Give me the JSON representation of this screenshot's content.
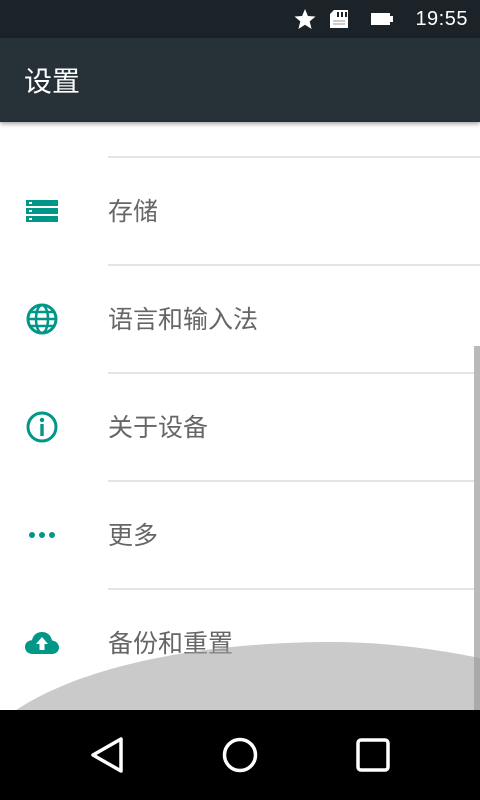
{
  "status_bar": {
    "time": "19:55",
    "icons": [
      "star-icon",
      "sd-card-icon",
      "battery-icon"
    ],
    "background": "#1b2328"
  },
  "toolbar": {
    "title": "设置",
    "background": "#263238"
  },
  "settings_items": [
    {
      "label": "存储",
      "icon": "storage-icon"
    },
    {
      "label": "语言和输入法",
      "icon": "globe-icon"
    },
    {
      "label": "关于设备",
      "icon": "info-icon"
    },
    {
      "label": "更多",
      "icon": "more-dots-icon"
    },
    {
      "label": "备份和重置",
      "icon": "cloud-upload-icon"
    }
  ],
  "accent_color": "#009688",
  "nav_bar": {
    "buttons": [
      "back-icon",
      "home-icon",
      "recents-icon"
    ]
  }
}
